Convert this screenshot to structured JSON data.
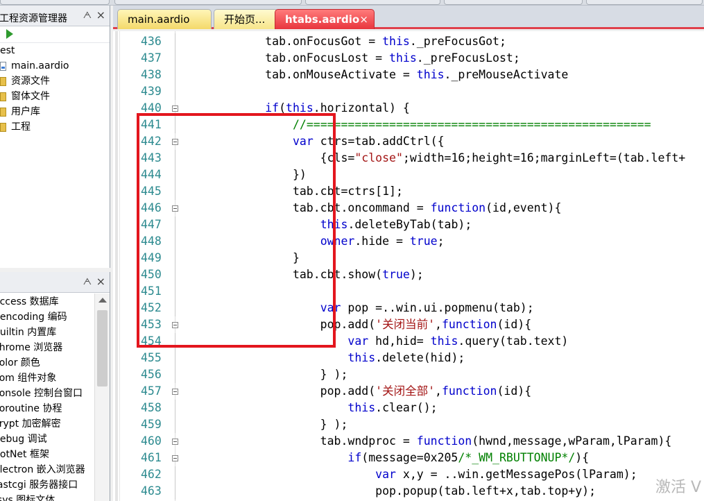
{
  "panels": {
    "project": {
      "title": "工程资源管理器",
      "pin_icon": "pin-icon",
      "close_icon": "close-icon",
      "tree": [
        {
          "label": "est",
          "type": "root"
        },
        {
          "label": "main.aardio",
          "type": "file"
        },
        {
          "label": "资源文件",
          "type": "folder"
        },
        {
          "label": "窗体文件",
          "type": "folder"
        },
        {
          "label": "用户库",
          "type": "folder"
        },
        {
          "label": "工程",
          "type": "folder"
        }
      ]
    },
    "library": {
      "items": [
        "access 数据库",
        "pencoding 编码",
        "builtin 内置库",
        "chrome 浏览器",
        "color 颜色",
        "com 组件对象",
        "console 控制台窗口",
        "coroutine 协程",
        "crypt 加密解密",
        "debug 调试",
        "dotNet 框架",
        "electron 嵌入浏览器",
        "fastcgi 服务器接口",
        "fsys 图标文体"
      ]
    }
  },
  "tabs": [
    {
      "label": "main.aardio",
      "active": false
    },
    {
      "label": "开始页...",
      "active": false
    },
    {
      "label": "htabs.aardio",
      "active": true,
      "close": "×"
    }
  ],
  "colors": {
    "accent": "#e3161e",
    "line_number": "#2c8a8f",
    "keyword": "#0000cc",
    "string": "#a31515",
    "comment": "#008000"
  },
  "code": [
    {
      "n": "436",
      "t": "            tab.onFocusGot = this._preFocusGot;"
    },
    {
      "n": "437",
      "t": "            tab.onFocusLost = this._preFocusLost;"
    },
    {
      "n": "438",
      "t": "            tab.onMouseActivate = this._preMouseActivate"
    },
    {
      "n": "439",
      "t": ""
    },
    {
      "n": "440",
      "t": "            if(this.horizontal) {",
      "fold": true
    },
    {
      "n": "441",
      "t": "                //=================================================="
    },
    {
      "n": "442",
      "t": "                var ctrs=tab.addCtrl({",
      "fold": true
    },
    {
      "n": "443",
      "t": "                    {cls=\"close\";width=16;height=16;marginLeft=(tab.left+"
    },
    {
      "n": "444",
      "t": "                })"
    },
    {
      "n": "445",
      "t": "                tab.cbt=ctrs[1];"
    },
    {
      "n": "446",
      "t": "                tab.cbt.oncommand = function(id,event){",
      "fold": true
    },
    {
      "n": "447",
      "t": "                    this.deleteByTab(tab);"
    },
    {
      "n": "448",
      "t": "                    owner.hide = true;"
    },
    {
      "n": "449",
      "t": "                }"
    },
    {
      "n": "450",
      "t": "                tab.cbt.show(true);"
    },
    {
      "n": "451",
      "t": ""
    },
    {
      "n": "452",
      "t": "                    var pop =..win.ui.popmenu(tab);"
    },
    {
      "n": "453",
      "t": "                    pop.add('关闭当前',function(id){",
      "fold": true
    },
    {
      "n": "454",
      "t": "                        var hd,hid= this.query(tab.text)"
    },
    {
      "n": "455",
      "t": "                        this.delete(hid);"
    },
    {
      "n": "456",
      "t": "                    } );"
    },
    {
      "n": "457",
      "t": "                    pop.add('关闭全部',function(id){",
      "fold": true
    },
    {
      "n": "458",
      "t": "                        this.clear();"
    },
    {
      "n": "459",
      "t": "                    } );"
    },
    {
      "n": "460",
      "t": "                    tab.wndproc = function(hwnd,message,wParam,lParam){",
      "fold": true
    },
    {
      "n": "461",
      "t": "                        if(message=0x205/*_WM_RBUTTONUP*/){",
      "fold": true
    },
    {
      "n": "462",
      "t": "                            var x,y = ..win.getMessagePos(lParam);"
    },
    {
      "n": "463",
      "t": "                            pop.popup(tab.left+x,tab.top+y);"
    }
  ],
  "watermark": "激活 V"
}
